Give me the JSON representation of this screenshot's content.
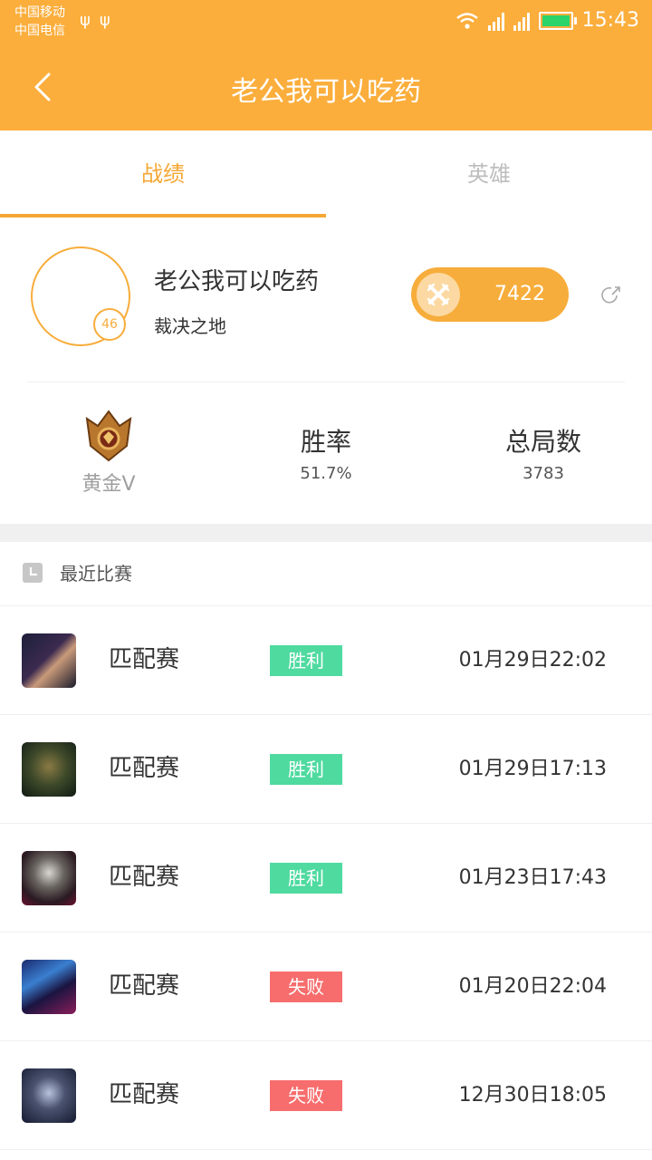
{
  "status_bar": {
    "carrier1": "中国移动",
    "carrier2": "中国电信",
    "time": "15:43",
    "network1": "2G",
    "network2": "4G 2G"
  },
  "header": {
    "title": "老公我可以吃药"
  },
  "tabs": [
    {
      "label": "战绩",
      "active": true
    },
    {
      "label": "英雄",
      "active": false
    }
  ],
  "profile": {
    "name": "老公我可以吃药",
    "server": "裁决之地",
    "level": "46",
    "score": "7422"
  },
  "stats": {
    "rank": "黄金V",
    "win_rate_label": "胜率",
    "win_rate": "51.7%",
    "total_games_label": "总局数",
    "total_games": "3783"
  },
  "recent": {
    "title": "最近比赛",
    "matches": [
      {
        "mode": "匹配赛",
        "result": "胜利",
        "outcome": "win",
        "time": "01月29日22:02",
        "hero_icon": "hero-portrait-1"
      },
      {
        "mode": "匹配赛",
        "result": "胜利",
        "outcome": "win",
        "time": "01月29日17:13",
        "hero_icon": "hero-portrait-2"
      },
      {
        "mode": "匹配赛",
        "result": "胜利",
        "outcome": "win",
        "time": "01月23日17:43",
        "hero_icon": "hero-portrait-3"
      },
      {
        "mode": "匹配赛",
        "result": "失败",
        "outcome": "lose",
        "time": "01月20日22:04",
        "hero_icon": "hero-portrait-4"
      },
      {
        "mode": "匹配赛",
        "result": "失败",
        "outcome": "lose",
        "time": "12月30日18:05",
        "hero_icon": "hero-portrait-5"
      }
    ]
  },
  "colors": {
    "brand": "#fbae3c",
    "win": "#4fdaa0",
    "lose": "#f76d6d"
  }
}
